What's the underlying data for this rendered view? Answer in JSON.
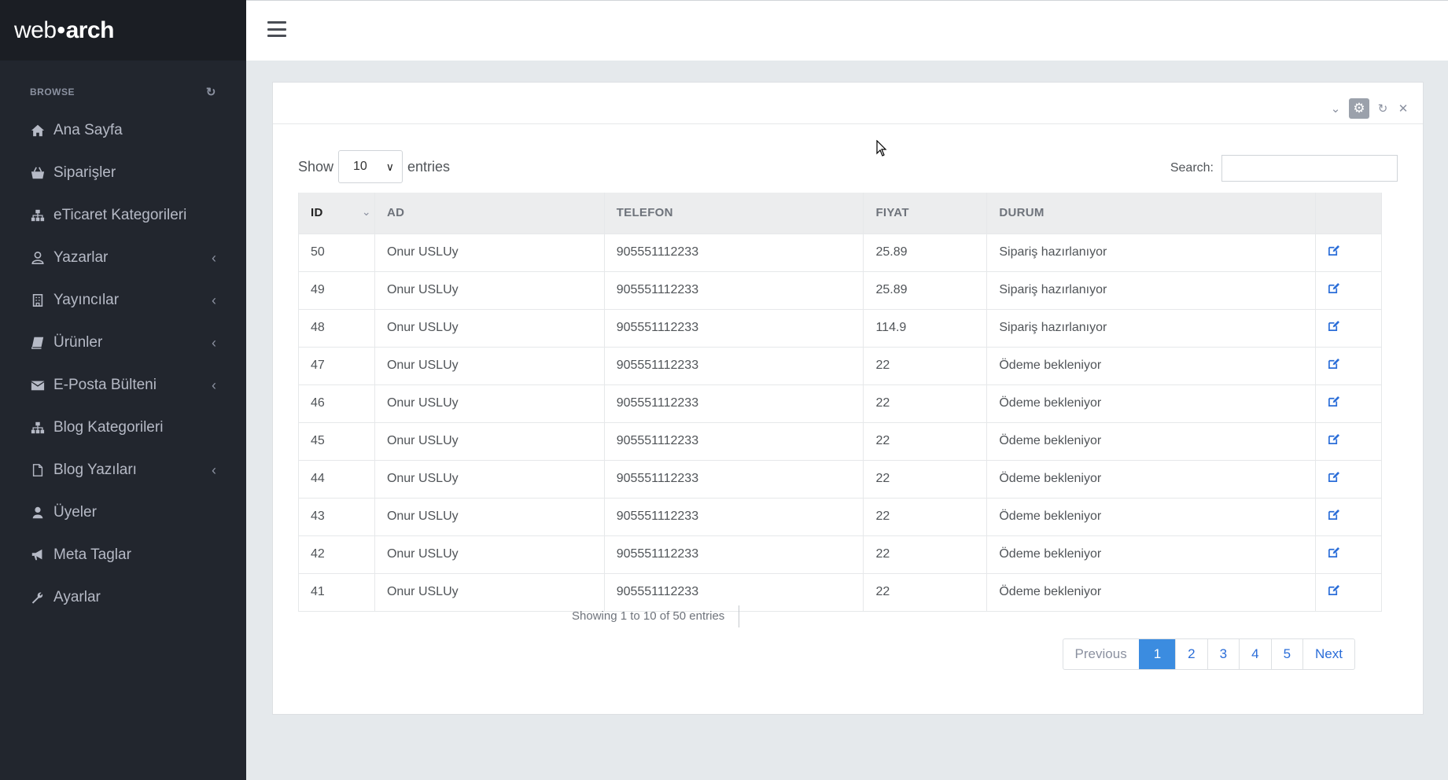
{
  "logo": {
    "part1": "web",
    "dot": "•",
    "part2": "arch"
  },
  "sidebar": {
    "section_label": "BROWSE",
    "items": [
      {
        "label": "Ana Sayfa",
        "icon": "home-icon",
        "chevron": false
      },
      {
        "label": "Siparişler",
        "icon": "basket-icon",
        "chevron": false
      },
      {
        "label": "eTicaret Kategorileri",
        "icon": "sitemap-icon",
        "chevron": false
      },
      {
        "label": "Yazarlar",
        "icon": "user-icon",
        "chevron": true
      },
      {
        "label": "Yayıncılar",
        "icon": "building-icon",
        "chevron": true
      },
      {
        "label": "Ürünler",
        "icon": "book-icon",
        "chevron": true
      },
      {
        "label": "E-Posta Bülteni",
        "icon": "envelope-icon",
        "chevron": true
      },
      {
        "label": "Blog Kategorileri",
        "icon": "sitemap-icon",
        "chevron": false
      },
      {
        "label": "Blog Yazıları",
        "icon": "file-icon",
        "chevron": true
      },
      {
        "label": "Üyeler",
        "icon": "user-solid-icon",
        "chevron": false
      },
      {
        "label": "Meta Taglar",
        "icon": "bullhorn-icon",
        "chevron": false
      },
      {
        "label": "Ayarlar",
        "icon": "wrench-icon",
        "chevron": false
      }
    ]
  },
  "controls": {
    "show_label": "Show",
    "page_size": "10",
    "entries_label": "entries",
    "search_label": "Search:",
    "search_value": ""
  },
  "table": {
    "headers": [
      "ID",
      "AD",
      "TELEFON",
      "FIYAT",
      "DURUM",
      ""
    ],
    "rows": [
      [
        "50",
        "Onur USLUy",
        "905551112233",
        "25.89",
        "Sipariş hazırlanıyor"
      ],
      [
        "49",
        "Onur USLUy",
        "905551112233",
        "25.89",
        "Sipariş hazırlanıyor"
      ],
      [
        "48",
        "Onur USLUy",
        "905551112233",
        "114.9",
        "Sipariş hazırlanıyor"
      ],
      [
        "47",
        "Onur USLUy",
        "905551112233",
        "22",
        "Ödeme bekleniyor"
      ],
      [
        "46",
        "Onur USLUy",
        "905551112233",
        "22",
        "Ödeme bekleniyor"
      ],
      [
        "45",
        "Onur USLUy",
        "905551112233",
        "22",
        "Ödeme bekleniyor"
      ],
      [
        "44",
        "Onur USLUy",
        "905551112233",
        "22",
        "Ödeme bekleniyor"
      ],
      [
        "43",
        "Onur USLUy",
        "905551112233",
        "22",
        "Ödeme bekleniyor"
      ],
      [
        "42",
        "Onur USLUy",
        "905551112233",
        "22",
        "Ödeme bekleniyor"
      ],
      [
        "41",
        "Onur USLUy",
        "905551112233",
        "22",
        "Ödeme bekleniyor"
      ]
    ]
  },
  "footer": {
    "info": "Showing 1 to 10 of 50 entries",
    "pagination": [
      "Previous",
      "1",
      "2",
      "3",
      "4",
      "5",
      "Next"
    ],
    "active_page": "1"
  },
  "colors": {
    "sidebar": "#22262e",
    "accent": "#3b8ce0",
    "link": "#2a6dd8"
  }
}
